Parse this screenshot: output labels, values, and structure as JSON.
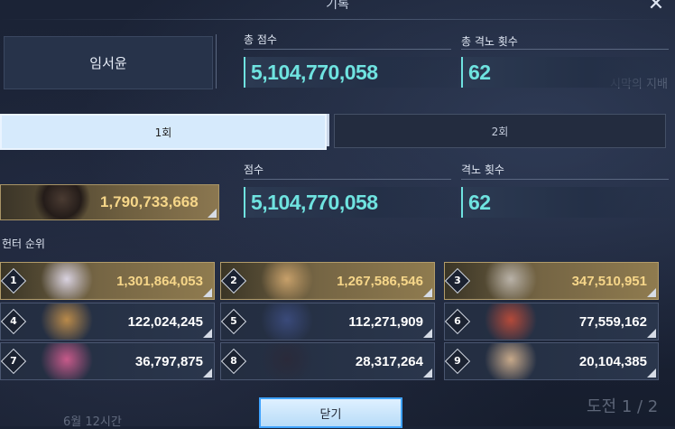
{
  "window": {
    "title": "기록",
    "close_glyph": "✕"
  },
  "user": {
    "name": "임서윤"
  },
  "summary": {
    "total_score_label": "총 점수",
    "total_score": "5,104,770,058",
    "total_defeats_label": "총 격노 횟수",
    "total_defeats": "62"
  },
  "background_text": {
    "top_right": "시막의 지배",
    "bottom_left": "6월 12시간",
    "bottom_right": "도전 1 / 2"
  },
  "tabs": [
    {
      "label": "1회",
      "active": true
    },
    {
      "label": "2회",
      "active": false
    }
  ],
  "round": {
    "hero_score": "1,790,733,668",
    "score_label": "점수",
    "score": "5,104,770,058",
    "defeats_label": "격노 횟수",
    "defeats": "62"
  },
  "ranking": {
    "label": "헌터 순위",
    "entries": [
      {
        "rank": "1",
        "value": "1,301,864,053",
        "tier": "gold",
        "portrait": "white-hair-portrait"
      },
      {
        "rank": "2",
        "value": "1,267,586,546",
        "tier": "gold",
        "portrait": "blonde-portrait"
      },
      {
        "rank": "3",
        "value": "347,510,951",
        "tier": "gold",
        "portrait": "old-man-portrait"
      },
      {
        "rank": "4",
        "value": "122,024,245",
        "tier": "blue",
        "portrait": "blonde-woman-portrait"
      },
      {
        "rank": "5",
        "value": "112,271,909",
        "tier": "blue",
        "portrait": "blue-hair-portrait"
      },
      {
        "rank": "6",
        "value": "77,559,162",
        "tier": "blue",
        "portrait": "red-hair-glasses-portrait"
      },
      {
        "rank": "7",
        "value": "36,797,875",
        "tier": "blue",
        "portrait": "pink-hair-portrait"
      },
      {
        "rank": "8",
        "value": "28,317,264",
        "tier": "blue",
        "portrait": "dark-hair-portrait"
      },
      {
        "rank": "9",
        "value": "20,104,385",
        "tier": "blue",
        "portrait": "brown-hair-portrait"
      }
    ]
  },
  "footer": {
    "close_label": "닫기"
  },
  "colors": {
    "accent_cyan": "#6fe3e0",
    "gold_text": "#f6d689",
    "button_border": "#3fa3ff"
  }
}
